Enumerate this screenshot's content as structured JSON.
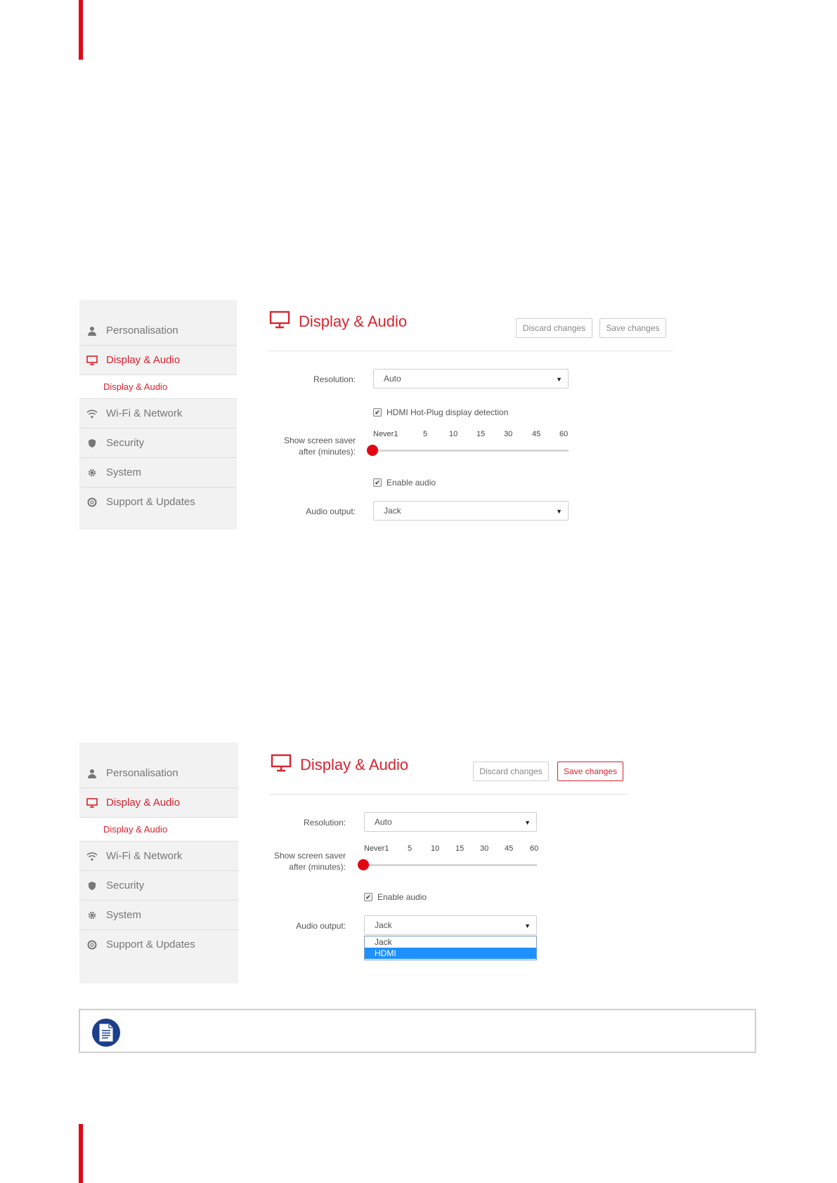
{
  "screens": [
    {
      "sidebar": {
        "items": [
          {
            "label": "Personalisation"
          },
          {
            "label": "Display & Audio"
          },
          {
            "label": "Display & Audio"
          },
          {
            "label": "Wi-Fi & Network"
          },
          {
            "label": "Security"
          },
          {
            "label": "System"
          },
          {
            "label": "Support & Updates"
          }
        ]
      },
      "header": {
        "title": "Display & Audio",
        "discard_label": "Discard changes",
        "save_label": "Save changes"
      },
      "form": {
        "resolution_label": "Resolution:",
        "resolution_value": "Auto",
        "hotplug_label": "HDMI Hot-Plug display detection",
        "screensaver_label_1": "Show screen saver",
        "screensaver_label_2": "after (minutes):",
        "ticks": [
          "Never1",
          "5",
          "10",
          "15",
          "30",
          "45",
          "60"
        ],
        "screensaver_value": "Never",
        "enable_audio_label": "Enable audio",
        "audio_output_label": "Audio output:",
        "audio_output_value": "Jack"
      }
    },
    {
      "sidebar": {
        "items": [
          {
            "label": "Personalisation"
          },
          {
            "label": "Display & Audio"
          },
          {
            "label": "Display & Audio"
          },
          {
            "label": "Wi-Fi & Network"
          },
          {
            "label": "Security"
          },
          {
            "label": "System"
          },
          {
            "label": "Support & Updates"
          }
        ]
      },
      "header": {
        "title": "Display & Audio",
        "discard_label": "Discard changes",
        "save_label": "Save changes"
      },
      "form": {
        "resolution_label": "Resolution:",
        "resolution_value": "Auto",
        "screensaver_label_1": "Show screen saver",
        "screensaver_label_2": "after (minutes):",
        "ticks": [
          "Never1",
          "5",
          "10",
          "15",
          "30",
          "45",
          "60"
        ],
        "screensaver_value": "Never",
        "enable_audio_label": "Enable audio",
        "audio_output_label": "Audio output:",
        "audio_output_value": "Jack",
        "audio_options": [
          "Jack",
          "HDMI"
        ],
        "highlighted_option": "HDMI"
      }
    }
  ],
  "colors": {
    "accent": "#d9232e",
    "slider_knob": "#e30613",
    "dropdown_highlight": "#1e90ff",
    "note_icon": "#1b3f8b"
  },
  "icons": [
    "user-icon",
    "monitor-icon",
    "wifi-icon",
    "shield-icon",
    "gear-icon",
    "lifebuoy-icon",
    "document-icon"
  ]
}
